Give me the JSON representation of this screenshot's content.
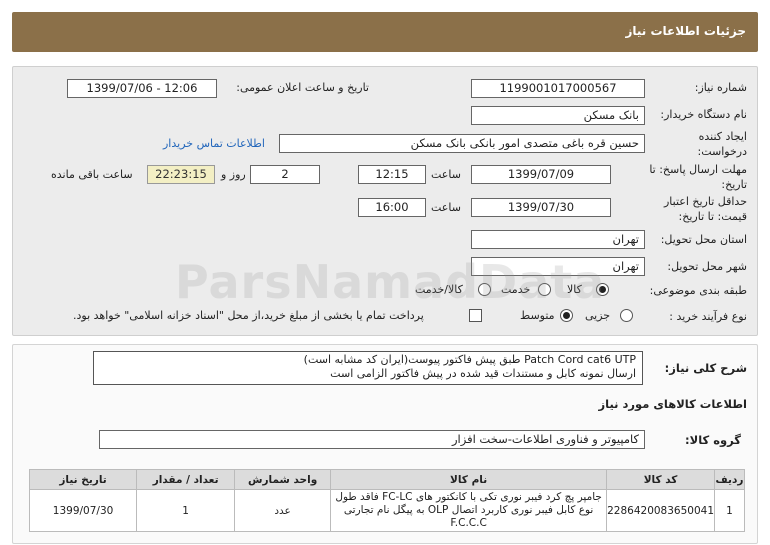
{
  "header": {
    "title": "جزئیات اطلاعات نیاز"
  },
  "fields": {
    "need_number_label": "شماره نیاز:",
    "need_number": "1199001017000567",
    "announce_label": "تاریخ و ساعت اعلان عمومی:",
    "announce_value": "1399/07/06 - 12:06",
    "buyer_org_label": "نام دستگاه خریدار:",
    "buyer_org": "بانک مسکن",
    "creator_label": "ایجاد کننده درخواست:",
    "creator": "حسین  قره باغی متصدی امور بانکی بانک مسکن",
    "contact_link": "اطلاعات تماس خریدار",
    "deadline_label": "مهلت ارسال پاسخ: تا تاریخ:",
    "deadline_date": "1399/07/09",
    "time_label": "ساعت",
    "deadline_time": "12:15",
    "days_value": "2",
    "day_and_label": "روز و",
    "remaining_time": "22:23:15",
    "remaining_label": "ساعت باقی مانده",
    "validity_label": "حداقل تاریخ اعتبار قیمت: تا تاریخ:",
    "validity_date": "1399/07/30",
    "validity_time": "16:00",
    "province_label": "استان محل تحویل:",
    "province": "تهران",
    "city_label": "شهر محل تحویل:",
    "city": "تهران",
    "category_label": "طبقه بندی موضوعی:",
    "category_options": [
      "کالا",
      "خدمت",
      "کالا/خدمت"
    ],
    "category_selected": "کالا",
    "process_label": "نوع فرآیند خرید :",
    "process_options": [
      "جزیی",
      "متوسط"
    ],
    "process_selected": "متوسط",
    "payment_note": "پرداخت تمام یا بخشی از مبلغ خرید،از محل \"اسناد خزانه اسلامی\" خواهد بود."
  },
  "description": {
    "label": "شرح کلی نیاز:",
    "line1": "Patch Cord cat6 UTP طبق پیش فاکتور پیوست(ایران کد مشابه است)",
    "line2": "ارسال نمونه کابل و مستندات قید شده در پیش فاکتور الزامی است"
  },
  "goods": {
    "section_title": "اطلاعات کالاهای مورد نیاز",
    "group_label": "گروه کالا:",
    "group_value": "کامپیوتر و فناوری اطلاعات-سخت افزار",
    "columns": [
      "ردیف",
      "کد کالا",
      "نام کالا",
      "واحد شمارش",
      "تعداد / مقدار",
      "تاریخ نیاز"
    ],
    "rows": [
      {
        "row": "1",
        "code": "2286420083650041",
        "name": "جامپر پچ کرد فیبر نوری تکی با کانکتور های FC-LC فاقد طول نوع کابل فیبر نوری کاربرد اتصال OLP به پیگل نام تجارتی F.C.C.C",
        "unit": "عدد",
        "qty": "1",
        "date": "1399/07/30"
      }
    ]
  },
  "watermark": "ParsNamadData"
}
